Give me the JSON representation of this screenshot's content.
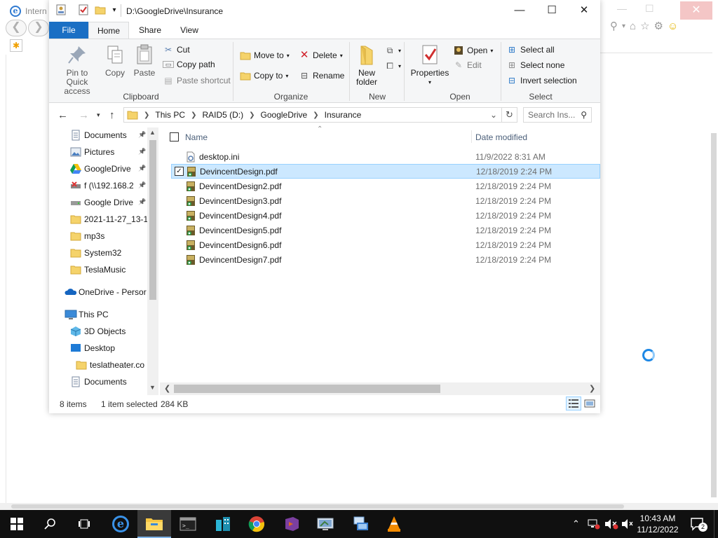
{
  "ie": {
    "title": "Intern",
    "back_label": "❮",
    "forward_label": "❯"
  },
  "explorer": {
    "title_path": "D:\\GoogleDrive\\Insurance",
    "window_minimize": "—",
    "window_maximize": "☐",
    "window_close": "✕",
    "tabs": [
      "File",
      "Home",
      "Share",
      "View"
    ],
    "ribbon": {
      "clipboard": {
        "label": "Clipboard",
        "pin_label_line1": "Pin to Quick",
        "pin_label_line2": "access",
        "copy": "Copy",
        "paste": "Paste",
        "cut": "Cut",
        "copy_path": "Copy path",
        "paste_shortcut": "Paste shortcut"
      },
      "organize": {
        "label": "Organize",
        "move_to": "Move to",
        "copy_to": "Copy to",
        "delete": "Delete",
        "rename": "Rename"
      },
      "new": {
        "label": "New",
        "new_folder_line1": "New",
        "new_folder_line2": "folder"
      },
      "open": {
        "label": "Open",
        "properties": "Properties",
        "open": "Open",
        "edit": "Edit"
      },
      "select": {
        "label": "Select",
        "select_all": "Select all",
        "select_none": "Select none",
        "invert_selection": "Invert selection"
      }
    },
    "address": {
      "segments": [
        "This PC",
        "RAID5 (D:)",
        "GoogleDrive",
        "Insurance"
      ],
      "search_placeholder": "Search Ins..."
    },
    "nav_pane": [
      {
        "label": "Documents",
        "icon": "documents-icon",
        "pinned": true
      },
      {
        "label": "Pictures",
        "icon": "pictures-icon",
        "pinned": true
      },
      {
        "label": "GoogleDrive",
        "icon": "google-drive-icon",
        "pinned": true
      },
      {
        "label": "f (\\\\192.168.2",
        "icon": "network-drive-icon",
        "pinned": true
      },
      {
        "label": "Google Drive",
        "icon": "drive-icon",
        "pinned": true
      },
      {
        "label": "2021-11-27_13-1",
        "icon": "folder-icon",
        "pinned": false
      },
      {
        "label": "mp3s",
        "icon": "folder-icon",
        "pinned": false
      },
      {
        "label": "System32",
        "icon": "folder-icon",
        "pinned": false
      },
      {
        "label": "TeslaMusic",
        "icon": "folder-icon",
        "pinned": false
      },
      {
        "label": "OneDrive - Persor",
        "icon": "onedrive-icon",
        "pinned": false
      },
      {
        "label": "This PC",
        "icon": "this-pc-icon",
        "pinned": false
      },
      {
        "label": "3D Objects",
        "icon": "3d-objects-icon",
        "pinned": false
      },
      {
        "label": "Desktop",
        "icon": "desktop-icon",
        "pinned": false
      },
      {
        "label": "teslatheater.co",
        "icon": "folder-icon",
        "pinned": false
      },
      {
        "label": "Documents",
        "icon": "documents-icon",
        "pinned": false
      }
    ],
    "columns": {
      "name": "Name",
      "date_modified": "Date modified"
    },
    "files": [
      {
        "name": "desktop.ini",
        "date": "11/9/2022 8:31 AM",
        "selected": false,
        "type": "ini"
      },
      {
        "name": "DevincentDesign.pdf",
        "date": "12/18/2019 2:24 PM",
        "selected": true,
        "type": "pdf"
      },
      {
        "name": "DevincentDesign2.pdf",
        "date": "12/18/2019 2:24 PM",
        "selected": false,
        "type": "pdf"
      },
      {
        "name": "DevincentDesign3.pdf",
        "date": "12/18/2019 2:24 PM",
        "selected": false,
        "type": "pdf"
      },
      {
        "name": "DevincentDesign4.pdf",
        "date": "12/18/2019 2:24 PM",
        "selected": false,
        "type": "pdf"
      },
      {
        "name": "DevincentDesign5.pdf",
        "date": "12/18/2019 2:24 PM",
        "selected": false,
        "type": "pdf"
      },
      {
        "name": "DevincentDesign6.pdf",
        "date": "12/18/2019 2:24 PM",
        "selected": false,
        "type": "pdf"
      },
      {
        "name": "DevincentDesign7.pdf",
        "date": "12/18/2019 2:24 PM",
        "selected": false,
        "type": "pdf"
      }
    ],
    "status": {
      "item_count": "8 items",
      "selection": "1 item selected",
      "size": "284 KB"
    }
  },
  "taskbar": {
    "time": "10:43 AM",
    "date": "11/12/2022",
    "notification_count": "2",
    "apps": [
      "start-icon",
      "search-icon",
      "task-view-icon",
      "internet-explorer-icon",
      "file-explorer-icon",
      "terminal-icon",
      "building-app-icon",
      "chrome-icon",
      "visual-studio-icon",
      "control-panel-icon",
      "remote-desktop-icon",
      "vlc-icon"
    ]
  },
  "colors": {
    "accent": "#1a6fc4",
    "selection": "#cce8ff",
    "taskbar": "#101010"
  }
}
